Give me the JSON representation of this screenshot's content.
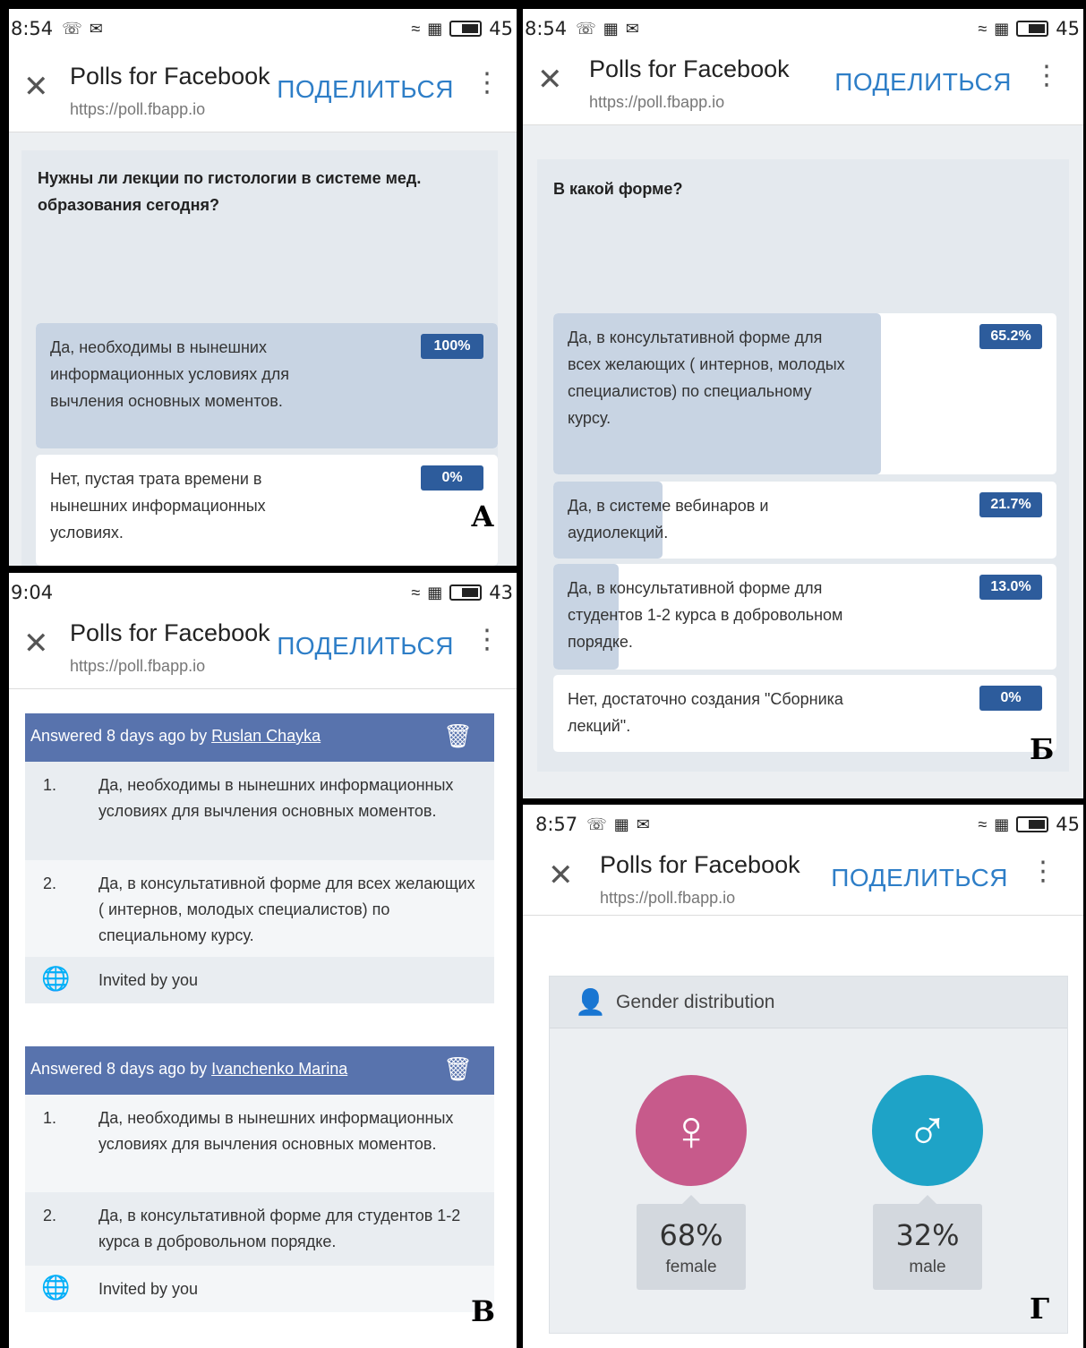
{
  "common": {
    "app_title": "Polls for Facebook",
    "app_url": "https://poll.fbapp.io",
    "share_label": "ПОДЕЛИТЬСЯ"
  },
  "panel_a": {
    "letter": "А",
    "time": "8:54",
    "battery": "45",
    "question": "Нужны ли лекции по гистологии в системе мед. образования сегодня?",
    "options": [
      {
        "text": "Да, необходимы в нынешних информационных условиях для вычления основных моментов.",
        "percent": "100%",
        "fill": 1.0
      },
      {
        "text": "Нет, пустая трата времени в нынешних информационных условиях.",
        "percent": "0%",
        "fill": 0.0
      }
    ]
  },
  "panel_b": {
    "letter": "Б",
    "time": "8:54",
    "battery": "45",
    "question": "В какой форме?",
    "options": [
      {
        "text": "Да, в консультативной форме для всех желающих ( интернов, молодых специалистов) по специальному курсу.",
        "percent": "65.2%",
        "fill": 0.652
      },
      {
        "text": "Да, в системе вебинаров и аудиолекций.",
        "percent": "21.7%",
        "fill": 0.217
      },
      {
        "text": "Да, в консультативной форме для студентов 1-2 курса в добровольном порядке.",
        "percent": "13.0%",
        "fill": 0.13
      },
      {
        "text": "Нет, достаточно создания \"Сборника лекций\".",
        "percent": "0%",
        "fill": 0.0
      }
    ]
  },
  "panel_v": {
    "letter": "В",
    "time": "9:04",
    "battery": "43",
    "answers": [
      {
        "prefix": "Answered 8 days ago by ",
        "user": "Ruslan Chayka",
        "items": [
          {
            "num": "1.",
            "text": "Да, необходимы в нынешних информационных условиях для вычления основных моментов."
          },
          {
            "num": "2.",
            "text": "Да, в консультативной форме для всех желающих ( интернов, молодых специалистов) по специальному курсу."
          }
        ],
        "invited": "Invited by you"
      },
      {
        "prefix": "Answered 8 days ago by ",
        "user": "Ivanchenko Marina",
        "items": [
          {
            "num": "1.",
            "text": "Да, необходимы в нынешних информационных условиях для вычления основных моментов."
          },
          {
            "num": "2.",
            "text": "Да, в консультативной форме для студентов 1-2 курса в добровольном порядке."
          }
        ],
        "invited": "Invited by you"
      }
    ]
  },
  "panel_g": {
    "letter": "Г",
    "time": "8:57",
    "battery": "45",
    "heading": "Gender distribution",
    "female": {
      "percent": "68%",
      "label": "female",
      "color": "#c75a8b"
    },
    "male": {
      "percent": "32%",
      "label": "male",
      "color": "#1ea3c7"
    }
  }
}
